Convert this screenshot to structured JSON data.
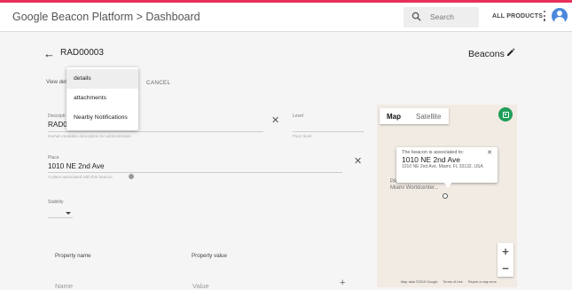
{
  "header": {
    "breadcrumb": "Google Beacon Platform > Dashboard",
    "search_placeholder": "Search",
    "all_products": "ALL PRODUCTS"
  },
  "page": {
    "beacon_title": "RAD00003",
    "beacons_label": "Beacons",
    "view_details_visible": "View det",
    "cancel": "CANCEL"
  },
  "menu": {
    "items": [
      "details",
      "attachments",
      "Nearby Notifications"
    ],
    "selected": "details"
  },
  "fields": {
    "description": {
      "label": "Descripti",
      "value": "RAD0",
      "help": "Human readable description for administration"
    },
    "level": {
      "label": "Level",
      "value": "",
      "help": "Floor level"
    },
    "place": {
      "label": "Place",
      "value": "1010 NE 2nd Ave",
      "help": "A place associated with this beacon"
    },
    "stability": {
      "label": "Stability",
      "value": ""
    }
  },
  "properties": {
    "name_header": "Property name",
    "value_header": "Property value",
    "name_placeholder": "Name",
    "value_placeholder": "Value"
  },
  "map": {
    "type_map": "Map",
    "type_satellite": "Satellite",
    "info_line1": "The beacon is associated to:",
    "info_title": "1010 NE 2nd Ave",
    "info_address": "1010 NE 2nd Ave, Miami, FL 33132, USA",
    "poi_label_a": "M",
    "poi_label_b": "PARAMOUNT",
    "poi_label_c": "Miami Worldcenter...",
    "attrib_data": "Map data ©2019 Google",
    "attrib_terms": "Terms of Use",
    "attrib_report": "Report a map error"
  },
  "colors": {
    "accent": "#e8305b",
    "fab": "#1e9e59",
    "avatar": "#4a89dc"
  }
}
